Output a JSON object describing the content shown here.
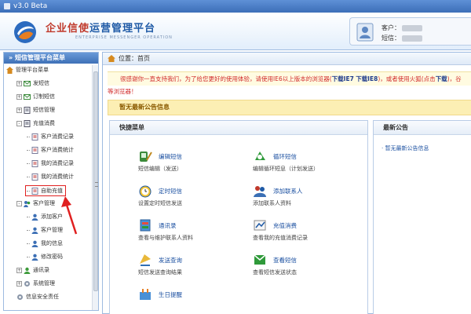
{
  "window": {
    "title": "v3.0 Beta"
  },
  "header": {
    "brand_title_red": "企业信使",
    "brand_title_blue": "运营管理平台",
    "brand_subtitle": "ENTERPRISE MESSENGER OPERATION",
    "customer_label": "客户：",
    "sms_label": "短信："
  },
  "sidebar": {
    "heading": "» 短信管理平台菜单",
    "items": [
      {
        "label": "管理平台菜单",
        "level": 0,
        "expander": "",
        "icon": "home-icon"
      },
      {
        "label": "发短信",
        "level": 1,
        "expander": "+",
        "icon": "mail-icon"
      },
      {
        "label": "订制短信",
        "level": 1,
        "expander": "+",
        "icon": "mail-icon"
      },
      {
        "label": "短信管理",
        "level": 1,
        "expander": "+",
        "icon": "doc-icon"
      },
      {
        "label": "充值消费",
        "level": 1,
        "expander": "-",
        "icon": "doc-icon"
      },
      {
        "label": "客户消费记录",
        "level": 2,
        "expander": "",
        "icon": "record-icon"
      },
      {
        "label": "客户消费统计",
        "level": 2,
        "expander": "",
        "icon": "record-icon"
      },
      {
        "label": "我的消费记录",
        "level": 2,
        "expander": "",
        "icon": "record-icon"
      },
      {
        "label": "我的消费统计",
        "level": 2,
        "expander": "",
        "icon": "record-icon"
      },
      {
        "label": "自助充值",
        "level": 2,
        "expander": "",
        "icon": "record-icon"
      },
      {
        "label": "客户管理",
        "level": 1,
        "expander": "-",
        "icon": "users-icon"
      },
      {
        "label": "添加客户",
        "level": 2,
        "expander": "",
        "icon": "user-icon"
      },
      {
        "label": "客户管理",
        "level": 2,
        "expander": "",
        "icon": "user-icon"
      },
      {
        "label": "我的信息",
        "level": 2,
        "expander": "",
        "icon": "user-icon"
      },
      {
        "label": "修改密码",
        "level": 2,
        "expander": "",
        "icon": "user-icon"
      },
      {
        "label": "通讯录",
        "level": 1,
        "expander": "+",
        "icon": "contacts-icon"
      },
      {
        "label": "系统管理",
        "level": 1,
        "expander": "+",
        "icon": "gear-icon"
      },
      {
        "label": "信息安全责任",
        "level": 1,
        "expander": "",
        "icon": "gear-icon"
      }
    ]
  },
  "content": {
    "breadcrumb_prefix": "位置：",
    "breadcrumb_page": "首页",
    "notice_text": "很感谢你一直支持我们，为了给您更好的使用体验，请使用IE6以上版本的浏览器(",
    "notice_link_ie7": "下载IE7",
    "notice_link_ie8": "下载IE8",
    "notice_text_2": ")，或者使用火狐(点击",
    "notice_link_ff": "下载",
    "notice_text_3": ")，谷",
    "notice_tail": "等浏览器！",
    "announcement": "暂无最新公告信息",
    "quick_menu_title": "快捷菜单",
    "quick_items": [
      {
        "title": "编辑短信",
        "desc": "短信编辑（发送）",
        "icon": "edit-sms-icon"
      },
      {
        "title": "循环短信",
        "desc": "编辑循环短息（计划发送）",
        "icon": "loop-sms-icon"
      },
      {
        "title": "定时短信",
        "desc": "设置定时短信发送",
        "icon": "alarm-clock-icon"
      },
      {
        "title": "添加联系人",
        "desc": "添加联系人资料",
        "icon": "add-contact-icon"
      },
      {
        "title": "通讯录",
        "desc": "查看与维护联系人资料",
        "icon": "address-book-icon"
      },
      {
        "title": "充值消费",
        "desc": "查看我的充值消费记录",
        "icon": "recharge-icon"
      },
      {
        "title": "发送查询",
        "desc": "短信发送查询结果",
        "icon": "send-query-icon"
      },
      {
        "title": "查看短信",
        "desc": "查看短信发送状态",
        "icon": "view-sms-icon"
      },
      {
        "title": "生日提醒",
        "desc": "",
        "icon": "birthday-icon"
      }
    ],
    "news_title": "最新公告",
    "news_items": [
      "· 暂无最新公告信息"
    ]
  },
  "colors": {
    "accent_red": "#d12b2b",
    "link_blue": "#1a4fa0",
    "header_blue": "#3e70b7"
  }
}
